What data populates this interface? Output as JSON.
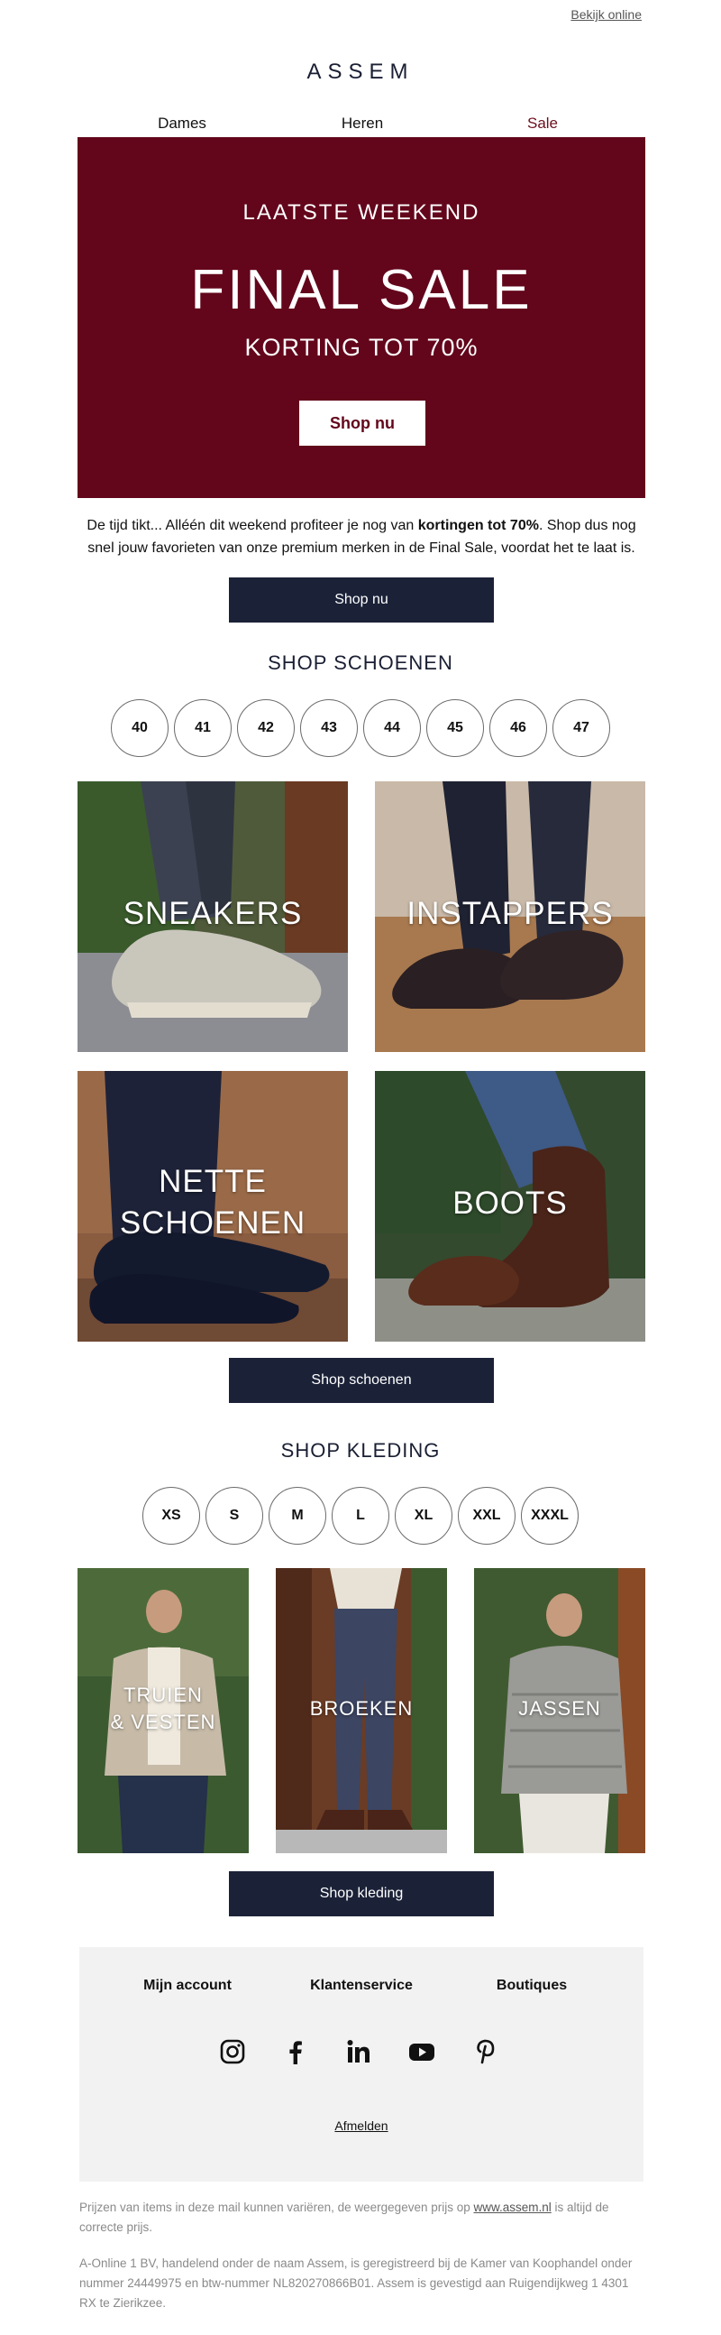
{
  "header": {
    "view_online": "Bekijk online",
    "logo": "ASSEM"
  },
  "nav": {
    "dames": "Dames",
    "heren": "Heren",
    "sale": "Sale"
  },
  "hero": {
    "eyebrow": "LAATSTE WEEKEND",
    "title": "FINAL SALE",
    "subtitle": "KORTING TOT 70%",
    "button": "Shop nu",
    "background_color": "#63061b"
  },
  "intro": {
    "text_before": "De tijd tikt... Alléén dit weekend profiteer je nog van ",
    "text_bold": "kortingen tot 70%",
    "text_after": ". Shop dus nog snel jouw favorieten van onze premium merken in de Final Sale, voordat het te laat is.",
    "button": "Shop nu"
  },
  "shoes": {
    "title": "SHOP SCHOENEN",
    "sizes": [
      "40",
      "41",
      "42",
      "43",
      "44",
      "45",
      "46",
      "47"
    ],
    "tiles": {
      "sneakers": "SNEAKERS",
      "instappers": "INSTAPPERS",
      "nette_line1": "NETTE",
      "nette_line2": "SCHOENEN",
      "boots": "BOOTS"
    },
    "button": "Shop schoenen"
  },
  "clothing": {
    "title": "SHOP KLEDING",
    "sizes": [
      "XS",
      "S",
      "M",
      "L",
      "XL",
      "XXL",
      "XXXL"
    ],
    "tiles": {
      "truien_line1": "TRUIEN",
      "truien_line2": "& VESTEN",
      "broeken": "BROEKEN",
      "jassen": "JASSEN"
    },
    "button": "Shop kleding"
  },
  "footer": {
    "links": [
      "Mijn account",
      "Klantenservice",
      "Boutiques"
    ],
    "social_icons": [
      "instagram-icon",
      "facebook-icon",
      "linkedin-icon",
      "youtube-icon",
      "pinterest-icon"
    ],
    "unsubscribe": "Afmelden"
  },
  "legal": {
    "prices_before": "Prijzen van items in deze mail kunnen variëren, de weergegeven prijs op ",
    "prices_link": "www.assem.nl",
    "prices_after": " is altijd de correcte prijs.",
    "company": "A-Online 1 BV, handelend onder de naam Assem, is geregistreerd bij de Kamer van Koophandel onder nummer 24449975 en btw-nummer NL820270866B01. Assem is gevestigd aan Ruigendijkweg 1 4301 RX te Zierikzee."
  },
  "colors": {
    "brand_dark": "#1b2238",
    "sale_red": "#6d0f1f"
  }
}
